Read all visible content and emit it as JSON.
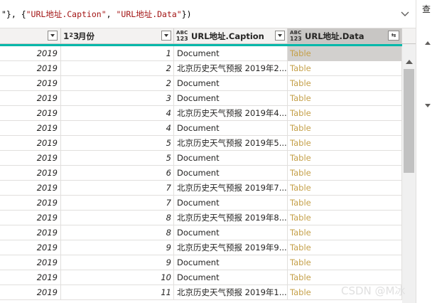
{
  "formula_bar": {
    "segments": [
      {
        "text": "\"}, {",
        "kind": "plain"
      },
      {
        "text": "\"URL地址.Caption\"",
        "kind": "str"
      },
      {
        "text": ", ",
        "kind": "plain"
      },
      {
        "text": "\"URL地址.Data\"",
        "kind": "str"
      },
      {
        "text": "})",
        "kind": "plain"
      }
    ],
    "chevron_icon": "chevron-down-icon"
  },
  "right_panel": {
    "label": "查"
  },
  "columns": [
    {
      "key": "year",
      "type_icon": "",
      "label": ""
    },
    {
      "key": "month",
      "type_icon": "integer-type-icon",
      "type_text": "1",
      "type_sup": "2",
      "type_tail": "3",
      "label": "月份"
    },
    {
      "key": "caption",
      "type_icon": "text-type-icon",
      "type_top": "ABC",
      "type_bottom": "123",
      "label": "URL地址.Caption"
    },
    {
      "key": "data",
      "type_icon": "any-type-icon",
      "type_top": "ABC",
      "type_bottom": "123",
      "label": "URL地址.Data",
      "expand_icon": "expand-columns-icon"
    }
  ],
  "rows": [
    {
      "year": "2019",
      "month": "1",
      "caption": "Document",
      "data": "Table"
    },
    {
      "year": "2019",
      "month": "2",
      "caption": "北京历史天气预报 2019年2...",
      "data": "Table"
    },
    {
      "year": "2019",
      "month": "2",
      "caption": "Document",
      "data": "Table"
    },
    {
      "year": "2019",
      "month": "3",
      "caption": "Document",
      "data": "Table"
    },
    {
      "year": "2019",
      "month": "4",
      "caption": "北京历史天气预报 2019年4...",
      "data": "Table"
    },
    {
      "year": "2019",
      "month": "4",
      "caption": "Document",
      "data": "Table"
    },
    {
      "year": "2019",
      "month": "5",
      "caption": "北京历史天气预报 2019年5...",
      "data": "Table"
    },
    {
      "year": "2019",
      "month": "5",
      "caption": "Document",
      "data": "Table"
    },
    {
      "year": "2019",
      "month": "6",
      "caption": "Document",
      "data": "Table"
    },
    {
      "year": "2019",
      "month": "7",
      "caption": "北京历史天气预报 2019年7...",
      "data": "Table"
    },
    {
      "year": "2019",
      "month": "7",
      "caption": "Document",
      "data": "Table"
    },
    {
      "year": "2019",
      "month": "8",
      "caption": "北京历史天气预报 2019年8...",
      "data": "Table"
    },
    {
      "year": "2019",
      "month": "8",
      "caption": "Document",
      "data": "Table"
    },
    {
      "year": "2019",
      "month": "9",
      "caption": "北京历史天气预报 2019年9...",
      "data": "Table"
    },
    {
      "year": "2019",
      "month": "9",
      "caption": "Document",
      "data": "Table"
    },
    {
      "year": "2019",
      "month": "10",
      "caption": "Document",
      "data": "Table"
    },
    {
      "year": "2019",
      "month": "11",
      "caption": "北京历史天气预报 2019年1...",
      "data": "Table"
    }
  ],
  "watermark": "CSDN @M冰",
  "colors": {
    "accent_teal": "#01b8aa",
    "table_link": "#c5a049",
    "selected_header": "#c8c6c4"
  }
}
